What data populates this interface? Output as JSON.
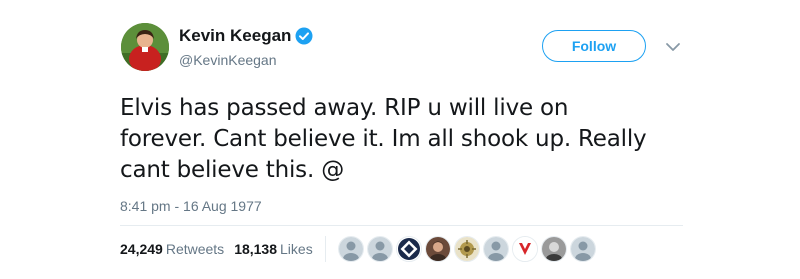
{
  "tweet": {
    "author": {
      "display_name": "Kevin Keegan",
      "handle": "@KevinKeegan",
      "verified": true
    },
    "follow_label": "Follow",
    "text_lines": [
      "Elvis has passed away. RIP u will live on",
      "forever. Cant believe it. Im all shook up. Really",
      "cant believe this. @"
    ],
    "timestamp": "8:41 pm - 16 Aug 1977",
    "retweets_count": "24,249",
    "retweets_label": "Retweets",
    "likes_count": "18,138",
    "likes_label": "Likes"
  },
  "icons": {
    "verified": "verified-badge-icon",
    "caret": "chevron-down-icon"
  },
  "colors": {
    "accent": "#1da1f2",
    "secondary_text": "#657786",
    "divider": "#e6ecf0"
  }
}
